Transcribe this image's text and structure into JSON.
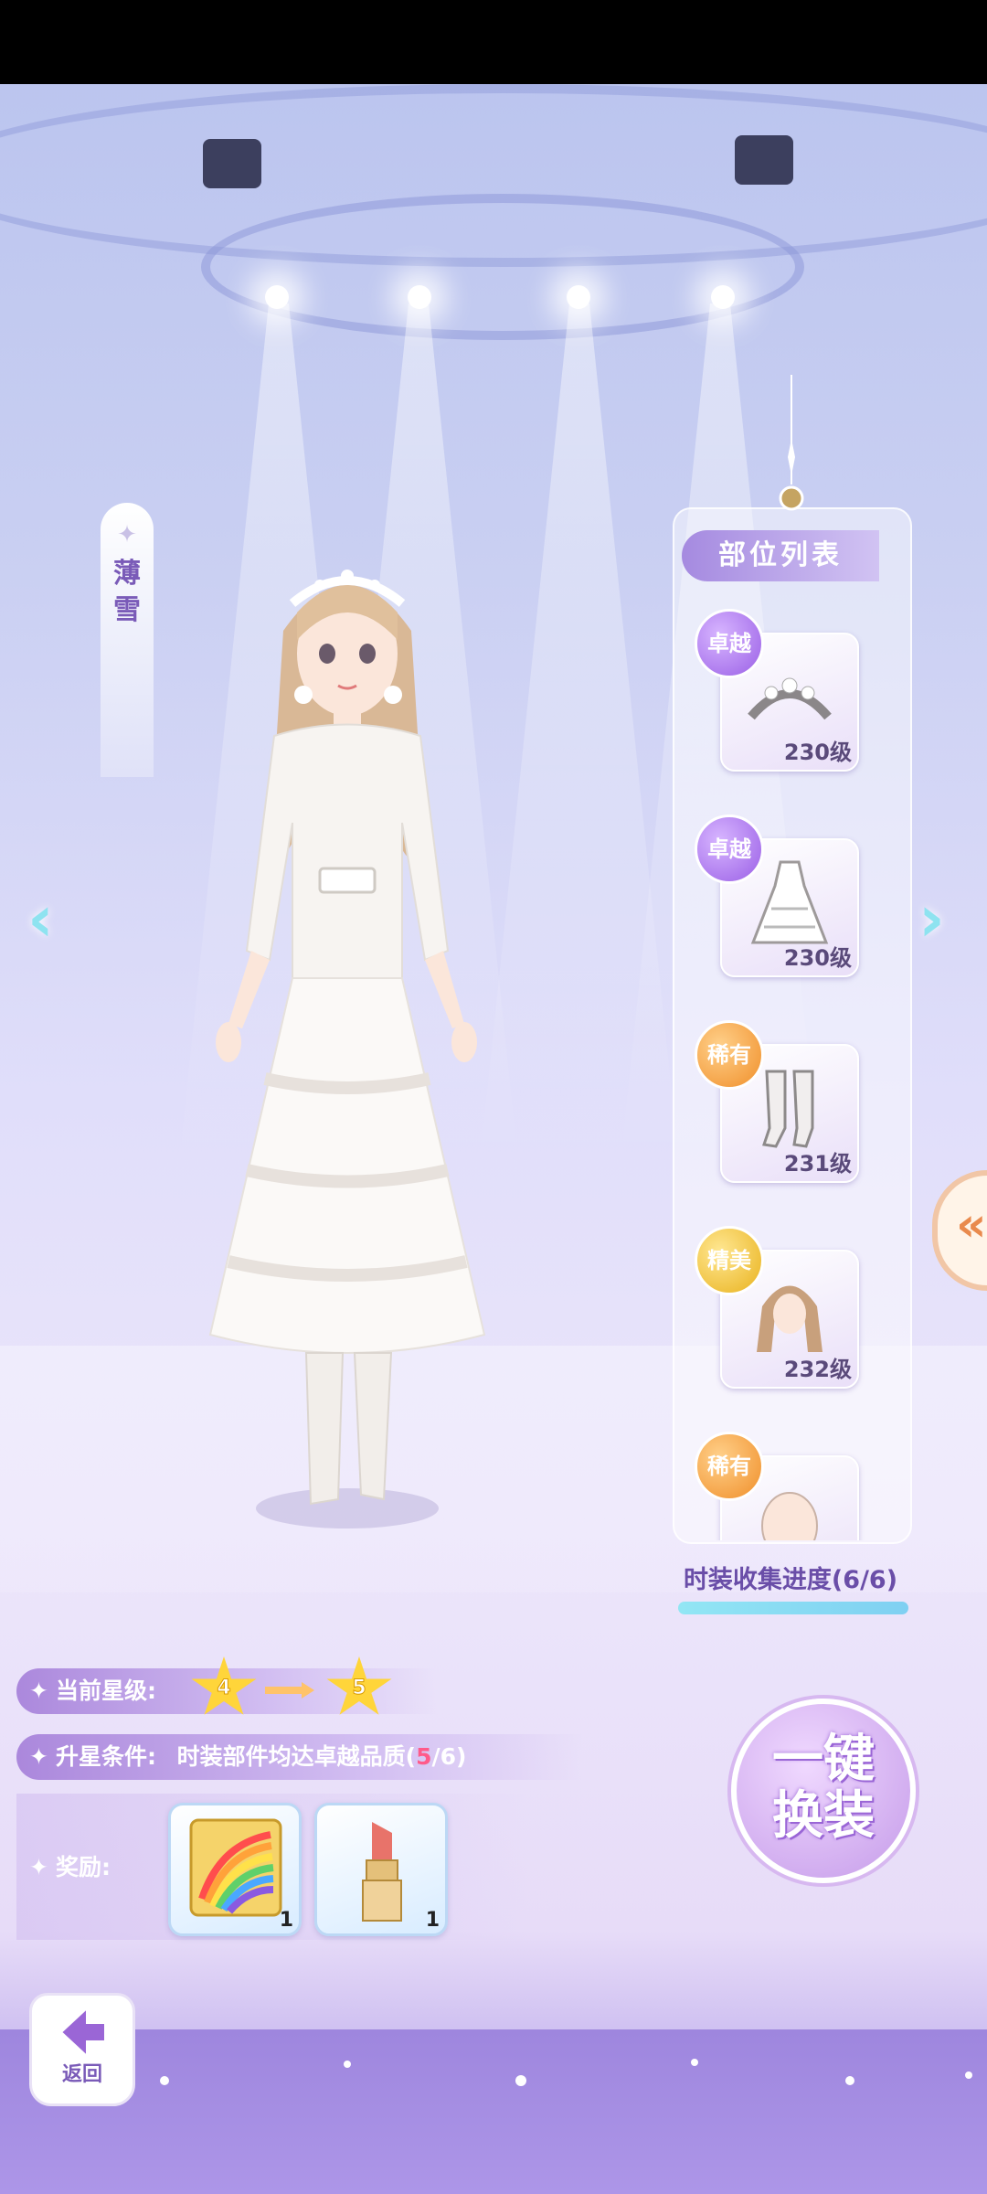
{
  "character": {
    "name": "薄雪"
  },
  "parts_panel": {
    "title": "部位列表",
    "items": [
      {
        "rarity": "卓越",
        "level": "230级",
        "type": "tiara"
      },
      {
        "rarity": "卓越",
        "level": "230级",
        "type": "dress"
      },
      {
        "rarity": "稀有",
        "level": "231级",
        "type": "socks"
      },
      {
        "rarity": "精美",
        "level": "232级",
        "type": "hair"
      },
      {
        "rarity": "稀有",
        "level": "",
        "type": "face"
      }
    ],
    "collection_label": "时装收集进度(6/6)",
    "collection_progress": 1.0
  },
  "star": {
    "label": "当前星级:",
    "current": "4",
    "next": "5"
  },
  "condition": {
    "label": "升星条件:",
    "text_prefix": "时装部件均达卓越品质(",
    "text_current": "5",
    "text_suffix": "/6)"
  },
  "reward": {
    "label": "奖励:",
    "items": [
      {
        "name": "rainbow-notebook",
        "count": "1"
      },
      {
        "name": "lipstick",
        "count": "1"
      }
    ]
  },
  "quick_outfit": {
    "line1": "一键",
    "line2": "换装"
  },
  "back": {
    "label": "返回"
  },
  "colors": {
    "accent_purple": "#9a66d6",
    "arrow_cyan": "#8ee3f0",
    "star_gold": "#ffd53a",
    "progress_blue": "#92e6f4",
    "highlight_pink": "#ff5a8a"
  },
  "icons": {
    "left_arrow": "chevron-left-icon",
    "right_arrow": "chevron-right-icon",
    "side_tab": "double-chevron-left-icon",
    "back": "back-arrow-icon",
    "sparkle": "sparkle-icon"
  }
}
